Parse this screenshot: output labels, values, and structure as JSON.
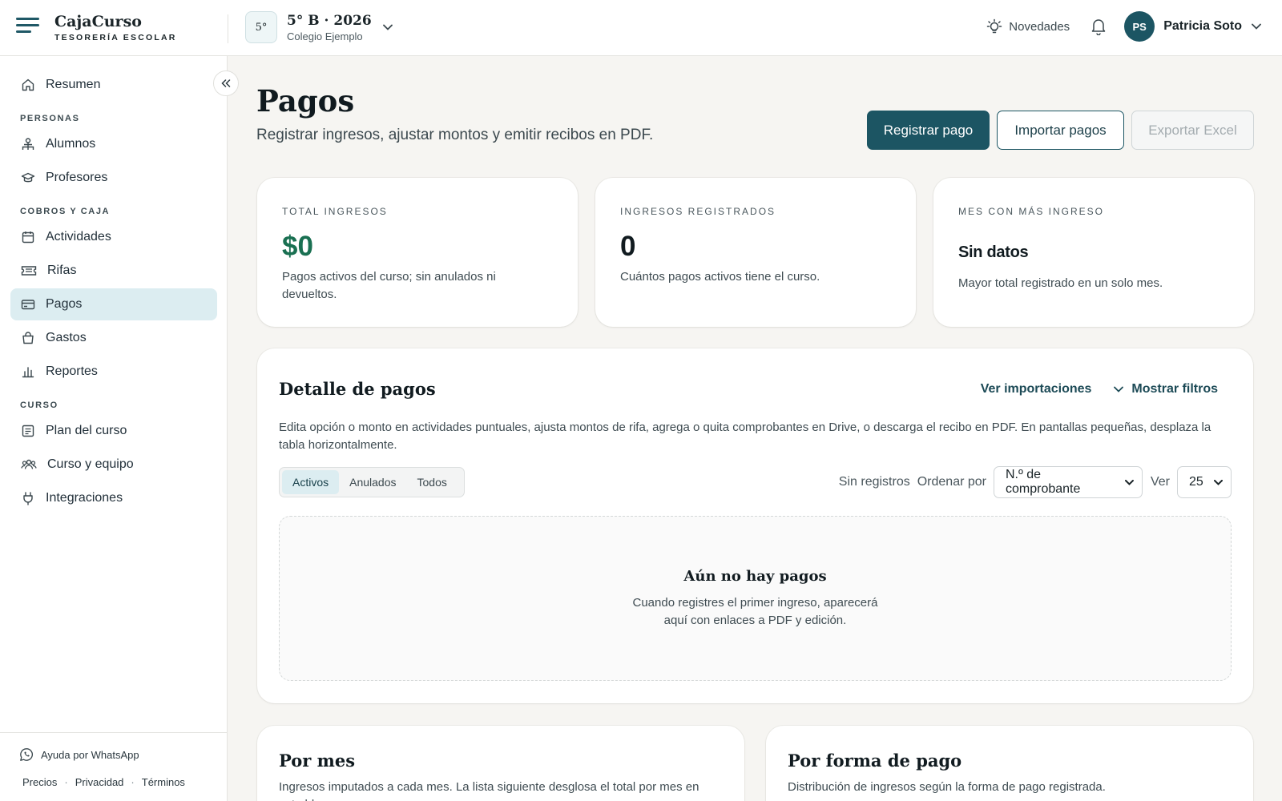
{
  "brand": {
    "name": "CajaCurso",
    "subtitle": "TESORERÍA ESCOLAR"
  },
  "course": {
    "badge": "5°",
    "title": "5° B · 2026",
    "school": "Colegio Ejemplo"
  },
  "header": {
    "news_label": "Novedades",
    "user_initials": "PS",
    "user_name": "Patricia Soto"
  },
  "sidebar": {
    "summary": "Resumen",
    "sections": {
      "personas": "PERSONAS",
      "cobros": "COBROS Y CAJA",
      "curso": "CURSO"
    },
    "items": {
      "alumnos": "Alumnos",
      "profesores": "Profesores",
      "actividades": "Actividades",
      "rifas": "Rifas",
      "pagos": "Pagos",
      "gastos": "Gastos",
      "reportes": "Reportes",
      "plan": "Plan del curso",
      "equipo": "Curso y equipo",
      "integraciones": "Integraciones"
    },
    "active": "pagos",
    "footer": {
      "whatsapp": "Ayuda por WhatsApp",
      "precios": "Precios",
      "privacidad": "Privacidad",
      "terminos": "Términos",
      "separator": "·"
    }
  },
  "page": {
    "title": "Pagos",
    "subtitle": "Registrar ingresos, ajustar montos y emitir recibos en PDF.",
    "actions": {
      "register": "Registrar pago",
      "import": "Importar pagos",
      "export": "Exportar Excel"
    }
  },
  "stats": [
    {
      "label": "TOTAL INGRESOS",
      "value": "$0",
      "desc": "Pagos activos del curso; sin anulados ni devueltos."
    },
    {
      "label": "INGRESOS REGISTRADOS",
      "value": "0",
      "desc": "Cuántos pagos activos tiene el curso."
    },
    {
      "label": "MES CON MÁS INGRESO",
      "value": "Sin datos",
      "desc": "Mayor total registrado en un solo mes."
    }
  ],
  "detail": {
    "title": "Detalle de pagos",
    "view_imports": "Ver importaciones",
    "show_filters": "Mostrar filtros",
    "desc": "Edita opción o monto en actividades puntuales, ajusta montos de rifa, agrega o quita comprobantes en Drive, o descarga el recibo en PDF. En pantallas pequeñas, desplaza la tabla horizontalmente.",
    "tabs": [
      "Activos",
      "Anulados",
      "Todos"
    ],
    "active_tab": "Activos",
    "record_count": "Sin registros",
    "order_label": "Ordenar por",
    "order_value": "N.º de comprobante",
    "view_label": "Ver",
    "view_value": "25",
    "empty_title": "Aún no hay pagos",
    "empty_desc_1": "Cuando registres el primer ingreso, aparecerá",
    "empty_desc_2": "aquí con enlaces a PDF y edición."
  },
  "by_month": {
    "title": "Por mes",
    "desc": "Ingresos imputados a cada mes. La lista siguiente desglosa el total por mes en este bloque."
  },
  "by_method": {
    "title": "Por forma de pago",
    "desc": "Distribución de ingresos según la forma de pago registrada."
  },
  "colors": {
    "primary": "#1c5563",
    "accent_green": "#1a7052",
    "active_bg": "#dcedf1"
  }
}
